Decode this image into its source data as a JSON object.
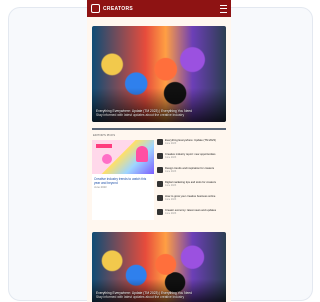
{
  "app": {
    "brand": "CREATORS"
  },
  "hero_top": {
    "caption": "Everything Everywhere: Update (TM 2023) | Everything You Need",
    "subcaption": "Stay informed with latest updates about the creative industry"
  },
  "section": {
    "label": "EDITOR'S PICKS"
  },
  "featured": {
    "title": "Creative industry trends to watch this year and beyond",
    "meta": "June 2023"
  },
  "side_list": [
    {
      "title": "Everything Everywhere: Update (TM 2023)",
      "date": "June 2023"
    },
    {
      "title": "Creative industry report: new opportunities",
      "date": "June 2023"
    },
    {
      "title": "Design trends and inspiration for creators",
      "date": "June 2023"
    },
    {
      "title": "Digital marketing tips and tools for creators",
      "date": "June 2023"
    },
    {
      "title": "How to grow your creative business online",
      "date": "June 2023"
    },
    {
      "title": "Creator economy: latest news and updates",
      "date": "June 2023"
    }
  ],
  "hero_bottom": {
    "caption": "Everything Everywhere: Update (TM 2023) | Everything You Need",
    "subcaption": "Stay informed with latest updates about the creative industry"
  },
  "colors": {
    "topbar": "#8e1313",
    "page_bg": "#fff7ef",
    "link_blue": "#1d4fa8"
  },
  "icons": {
    "logo": "logo-icon",
    "menu": "hamburger-menu-icon"
  }
}
